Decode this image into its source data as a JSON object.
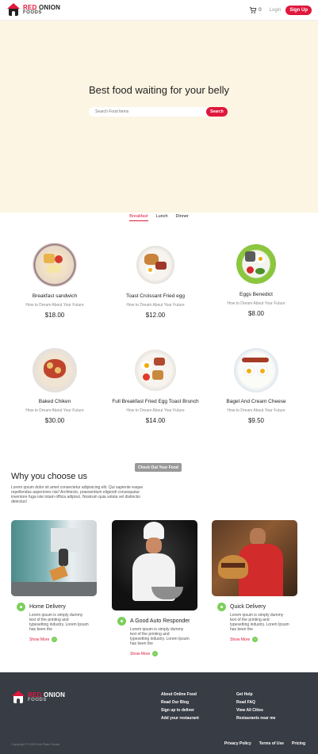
{
  "header": {
    "logo_line1_red": "RED",
    "logo_line1_dark": "ONION",
    "logo_line2": "FOODS",
    "cart_count": "0",
    "login_label": "Login",
    "signup_label": "Sign Up"
  },
  "hero": {
    "title": "Best food waiting for your belly",
    "search_placeholder": "Search Food Items",
    "search_button": "Search"
  },
  "tabs": [
    {
      "label": "Breakfast",
      "active": true
    },
    {
      "label": "Lunch",
      "active": false
    },
    {
      "label": "Dinner",
      "active": false
    }
  ],
  "foods": [
    {
      "name": "Breakfast sandwich",
      "desc": "How to Dream About Your Future",
      "price": "$18.00"
    },
    {
      "name": "Toast Croissant Fried egg",
      "desc": "How to Dream About Your Future",
      "price": "$12.00"
    },
    {
      "name": "Eggs Benedict",
      "desc": "How to Dream About Your Future",
      "price": "$8.00"
    },
    {
      "name": "Baked Chiken",
      "desc": "How to Dream About Your Future",
      "price": "$30.00"
    },
    {
      "name": "Full Breakfast Fried Egg Toast Brunch",
      "desc": "How to Dream About Your Future",
      "price": "$14.00"
    },
    {
      "name": "Bagel And Cream Cheese",
      "desc": "How to Dream About Your Future",
      "price": "$9.50"
    }
  ],
  "checkout_label": "Check Out Your Food",
  "why": {
    "title": "Why you choose us",
    "text": "Lorem ipsum dolor sit amet consectetur adipisicing elit. Qui sapiente eaque repellendus asperiores nisi! Architecto, praesentium eligendi consequatur inventore fuga iste totam officia adipisci. Nostrum quia soluta vel distinctio delectus!"
  },
  "features": [
    {
      "title": "Home Delivery",
      "body": "Lorem ipsum is simply dummy text of the printing and typesetting industry. Lorem Ipsum has been the",
      "more": "Show More"
    },
    {
      "title": "A Good Auto Responder",
      "body": "Lorem ipsum is simply dummy text of the printing and typesetting industry. Lorem Ipsum has been the",
      "more": "Show More"
    },
    {
      "title": "Quick Delivery",
      "body": "Lorem ipsum is simply dummy text of the printing and typesetting industry. Lorem Ipsum has been the",
      "more": "Show More"
    }
  ],
  "footer": {
    "col1": [
      "About Online Food",
      "Read Our Blog",
      "Sign up to deliver",
      "Add your restaurant"
    ],
    "col2": [
      "Get Help",
      "Read FAQ",
      "View All Cities",
      "Restaurants near me"
    ],
    "copyright": "Copyright © 2020 Hot Plate Foods",
    "bottom": [
      "Privacy Policy",
      "Terms of Use",
      "Pricing"
    ]
  },
  "colors": {
    "accent": "#e0183d",
    "hero_bg": "#fcf5e3",
    "footer_bg": "#383c44",
    "icon_green": "#7ccf5a"
  }
}
